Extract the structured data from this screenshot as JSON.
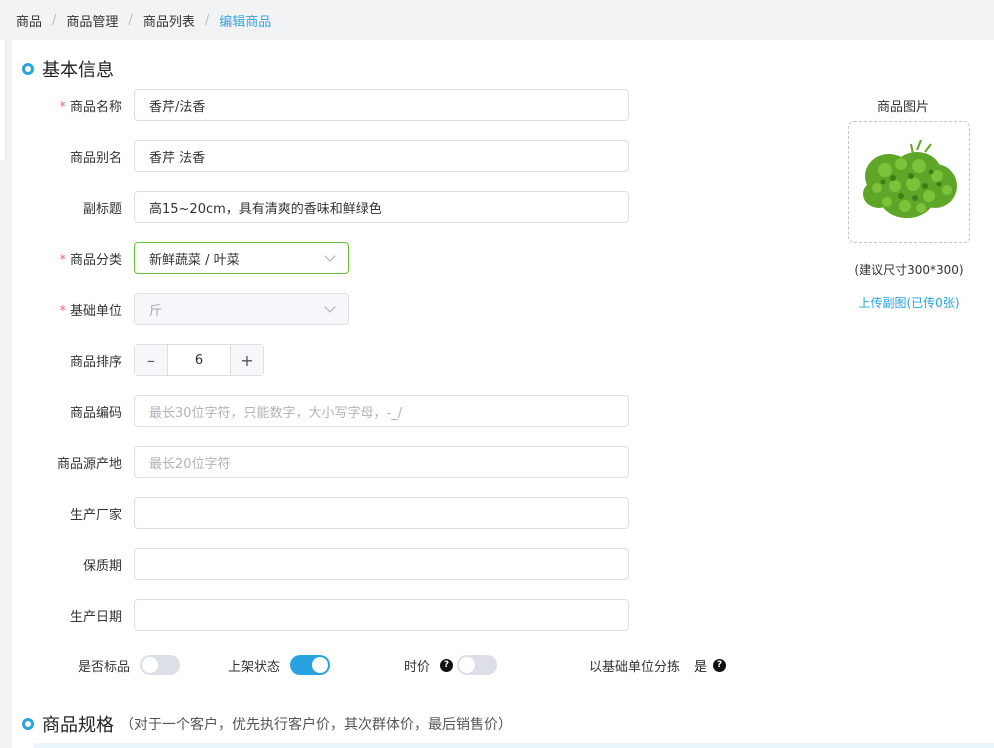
{
  "breadcrumb": [
    "商品",
    "商品管理",
    "商品列表",
    "编辑商品"
  ],
  "sections": {
    "basic_info": "基本信息",
    "spec": "商品规格",
    "spec_note": "（对于一个客户，优先执行客户价，其次群体价，最后销售价）"
  },
  "form": {
    "name_label": "商品名称",
    "name_value": "香芹/法香",
    "alias_label": "商品别名",
    "alias_value": "香芹 法香",
    "subtitle_label": "副标题",
    "subtitle_value": "高15~20cm，具有清爽的香味和鲜绿色",
    "category_label": "商品分类",
    "category_value": "新鲜蔬菜 / 叶菜",
    "unit_label": "基础单位",
    "unit_value": "斤",
    "sort_label": "商品排序",
    "sort_value": "6",
    "code_label": "商品编码",
    "code_placeholder": "最长30位字符，只能数字，大小写字母，-_/",
    "origin_label": "商品源产地",
    "origin_placeholder": "最长20位字符",
    "maker_label": "生产厂家",
    "maker_value": "",
    "shelf_label": "保质期",
    "shelf_value": "",
    "date_label": "生产日期",
    "date_value": ""
  },
  "toggles": {
    "standard_label": "是否标品",
    "standard_on": false,
    "listed_label": "上架状态",
    "listed_on": true,
    "timeprice_label": "时价",
    "timeprice_on": false,
    "sort_by_unit_label": "以基础单位分拣",
    "sort_by_unit_value": "是"
  },
  "image": {
    "title": "商品图片",
    "hint": "(建议尺寸300*300)",
    "upload_link": "上传副图(已传0张)"
  },
  "colors": {
    "accent": "#29a3e0",
    "required": "#f56c6c",
    "focus_border": "#67c23a"
  },
  "icons": [
    "minus-icon",
    "plus-icon",
    "chevron-down-icon",
    "question-icon"
  ]
}
